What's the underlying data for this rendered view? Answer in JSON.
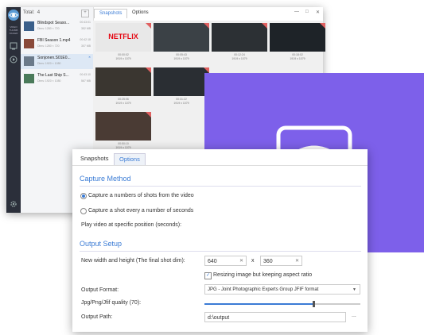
{
  "main_window": {
    "total_label": "Total:",
    "total_count": "4",
    "add_label": "+",
    "sidebar_tag": "VIDEO THUMB NAILER",
    "tabs": [
      "Snapshots",
      "Options"
    ],
    "window_controls": [
      "—",
      "□",
      "✕"
    ],
    "files": [
      {
        "name": "Blindspot Seaso...",
        "dims": "Dims: 1280 × 720",
        "duration": "00:43:01",
        "size": "352 MB",
        "thumb": "#3a5f8a"
      },
      {
        "name": "FBI Season 1.mp4",
        "dims": "Dims: 1280 × 720",
        "duration": "00:42:18",
        "size": "307 MB",
        "thumb": "#8a4a3a"
      },
      {
        "name": "Sonjonen.S01E0...",
        "dims": "Dims: 1920 × 1080",
        "duration": "",
        "size": "",
        "thumb": "#6b7a8a"
      },
      {
        "name": "The Last Ship S...",
        "dims": "Dims: 1920 × 1080",
        "duration": "00:43:10",
        "size": "567 MB",
        "thumb": "#4a7a5a"
      }
    ],
    "shots": [
      {
        "time": "00:00:02",
        "size": "1919 x 1079",
        "color": "#e8e8e8",
        "logo": "NETFLIX"
      },
      {
        "time": "00:05:43",
        "size": "1919 x 1079",
        "color": "#3b4146",
        "logo": ""
      },
      {
        "time": "00:12:24",
        "size": "1919 x 1079",
        "color": "#2c3034",
        "logo": ""
      },
      {
        "time": "00:18:02",
        "size": "1919 x 1079",
        "color": "#1e2328",
        "logo": ""
      },
      {
        "time": "00:25:06",
        "size": "1919 x 1079",
        "color": "#3a3630",
        "logo": ""
      },
      {
        "time": "00:31:22",
        "size": "1919 x 1079",
        "color": "#2a2e33",
        "logo": ""
      },
      {
        "time": "00:50:10",
        "size": "1919 x 1079",
        "color": "#4a3b34",
        "logo": ""
      }
    ]
  },
  "options_dialog": {
    "tabs": [
      "Snapshots",
      "Options"
    ],
    "capture_method": {
      "heading": "Capture Method",
      "option1": "Capture a numbers of shots from the video",
      "option2": "Capture a shot every a number of seconds",
      "play_label": "Play video at specific position (seconds):"
    },
    "output_setup": {
      "heading": "Output Setup",
      "size_label": "New width and height (The final shot dim):",
      "width": "640",
      "height": "360",
      "x_sep": "x",
      "clear": "✕",
      "resize_label": "Resizing image but keeping aspect ratio",
      "resize_checked": true,
      "format_label": "Output Format:",
      "format_value": "JPG  - Joint Photographic Experts Group JFIF format",
      "quality_label": "Jpg/Png/Jfif quality (70):",
      "quality_value": 0.7,
      "path_label": "Output Path:",
      "path_value": "d:\\output",
      "browse": "..."
    }
  },
  "colors": {
    "accent": "#3a7bd5",
    "purple": "#7d60ea",
    "sidebar": "#2b2f3a"
  },
  "icons": [
    "eye-logo-icon",
    "snapshot-icon",
    "video-icon",
    "settings-gear-icon"
  ]
}
